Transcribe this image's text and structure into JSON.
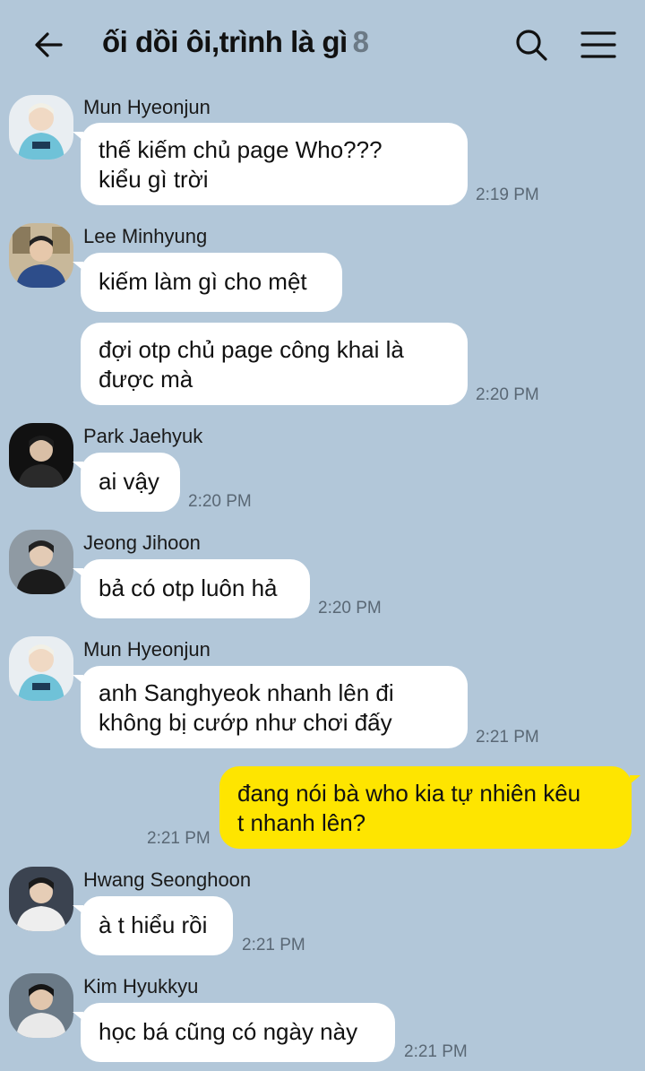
{
  "header": {
    "title": "ối dồi ôi,trình là gì",
    "member_count": "8",
    "back_icon": "arrow-left-icon",
    "search_icon": "search-icon",
    "menu_icon": "hamburger-menu-icon"
  },
  "colors": {
    "background": "#b2c7d9",
    "incoming_bubble": "#ffffff",
    "outgoing_bubble": "#fee500"
  },
  "messages": [
    {
      "sender": "Mun Hyeonjun",
      "text": "thế kiếm chủ page Who???\nkiểu gì trời",
      "time": "2:19 PM"
    },
    {
      "sender": "Lee Minhyung",
      "text": "kiếm làm gì cho mệt"
    },
    {
      "text": "đợi otp chủ page công khai là\nđược mà",
      "time": "2:20 PM"
    },
    {
      "sender": "Park Jaehyuk",
      "text": "ai vậy",
      "time": "2:20 PM"
    },
    {
      "sender": "Jeong Jihoon",
      "text": "bả có otp luôn hả",
      "time": "2:20 PM"
    },
    {
      "sender": "Mun Hyeonjun",
      "text": "anh Sanghyeok nhanh lên đi\nkhông bị cướp như chơi đấy",
      "time": "2:21 PM"
    },
    {
      "text": "đang nói bà who kia tự nhiên kêu\nt nhanh lên?",
      "time": "2:21 PM"
    },
    {
      "sender": "Hwang Seonghoon",
      "text": "à t hiểu rồi",
      "time": "2:21 PM"
    },
    {
      "sender": "Kim Hyukkyu",
      "text": "học bá cũng có ngày này",
      "time": "2:21 PM"
    }
  ]
}
